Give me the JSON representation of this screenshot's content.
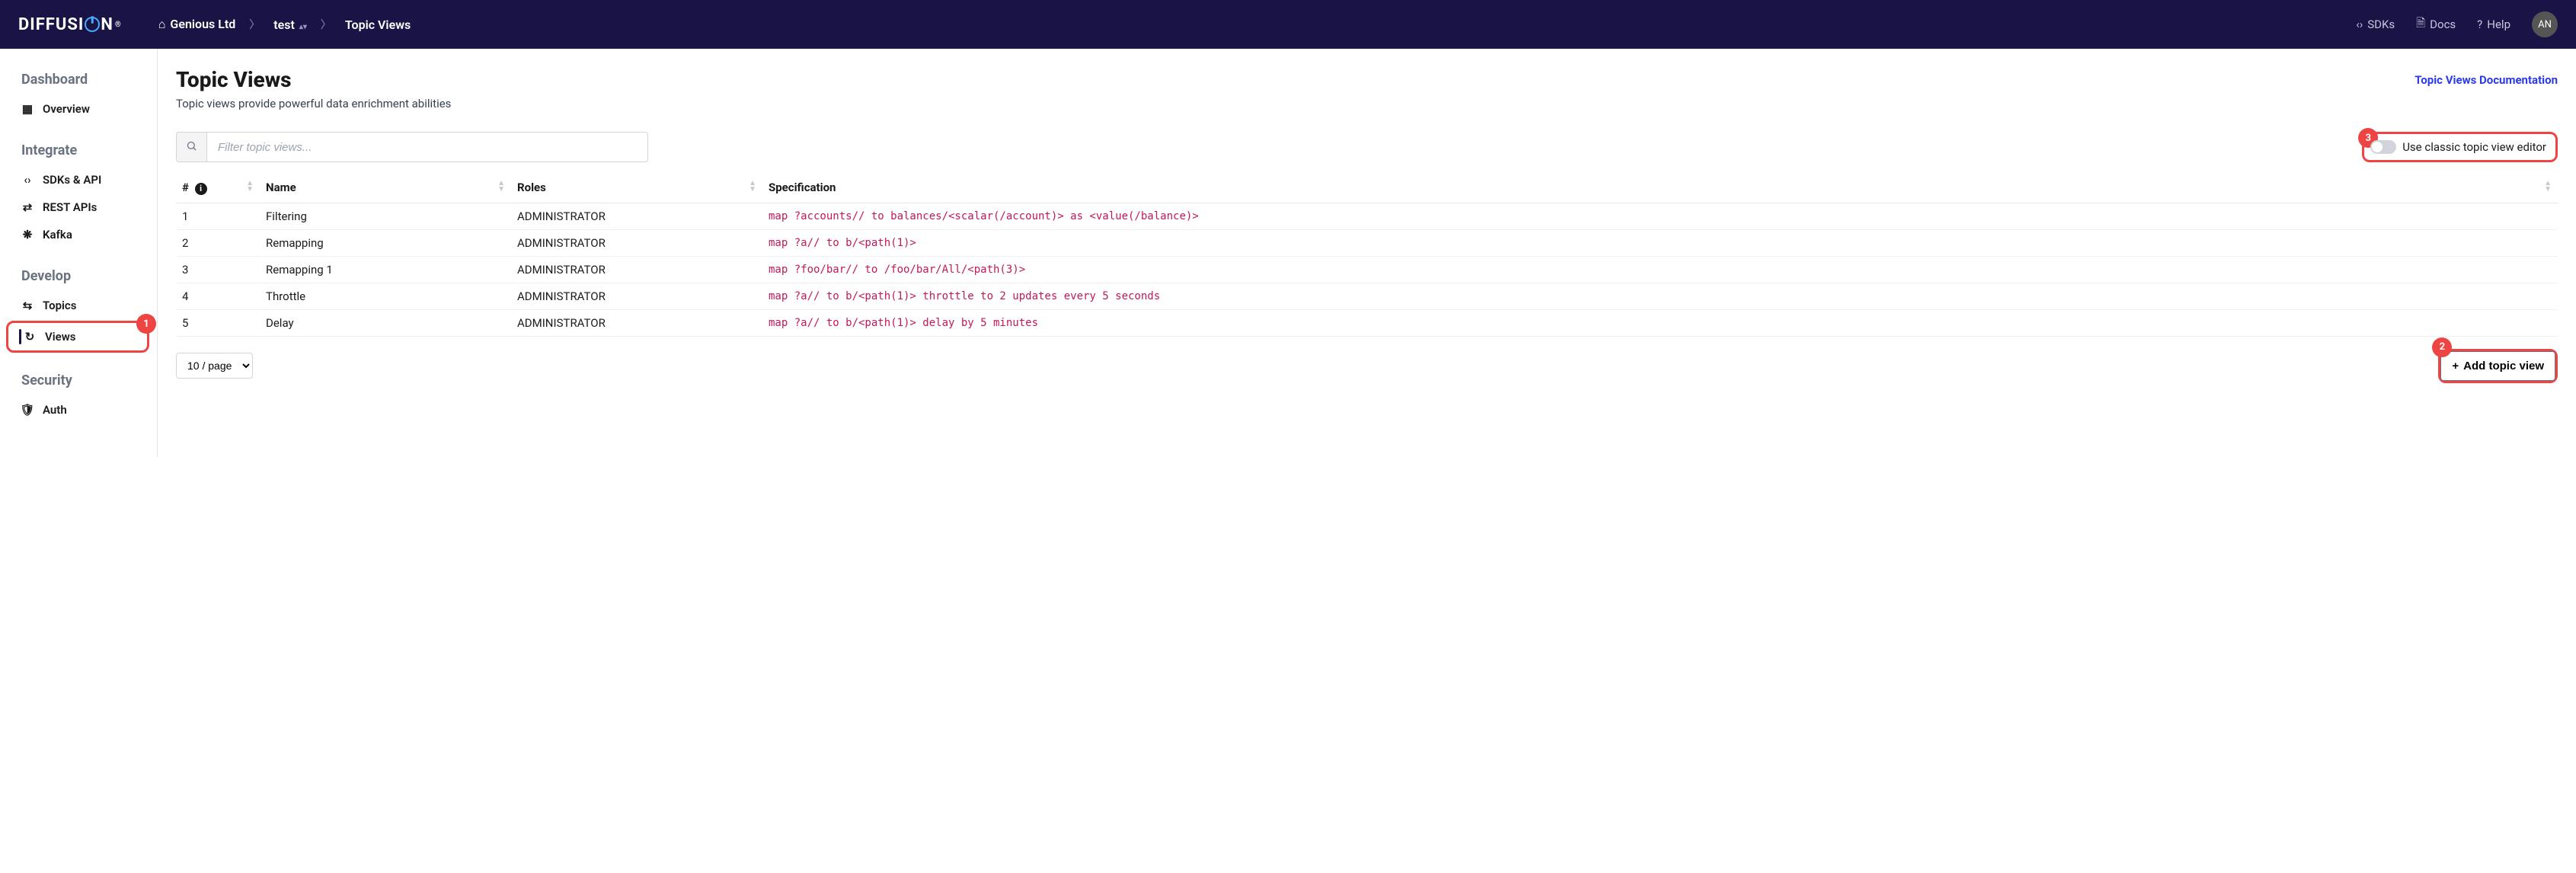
{
  "brand": {
    "pre": "DIFFUSI",
    "post": "N"
  },
  "breadcrumb": {
    "org": "Genious Ltd",
    "project": "test",
    "page": "Topic Views"
  },
  "top_links": {
    "sdks": "SDKs",
    "docs": "Docs",
    "help": "Help"
  },
  "avatar_initials": "AN",
  "sidebar": {
    "dashboard_heading": "Dashboard",
    "overview": "Overview",
    "integrate_heading": "Integrate",
    "sdks_api": "SDKs & API",
    "rest_apis": "REST APIs",
    "kafka": "Kafka",
    "develop_heading": "Develop",
    "topics": "Topics",
    "views": "Views",
    "security_heading": "Security",
    "auth": "Auth"
  },
  "page": {
    "title": "Topic Views",
    "subtitle": "Topic views provide powerful data enrichment abilities",
    "doc_link": "Topic Views Documentation"
  },
  "search": {
    "placeholder": "Filter topic views..."
  },
  "toggle": {
    "label": "Use classic topic view editor"
  },
  "callouts": {
    "c1": "1",
    "c2": "2",
    "c3": "3"
  },
  "columns": {
    "num": "#",
    "name": "Name",
    "roles": "Roles",
    "spec": "Specification"
  },
  "rows": [
    {
      "n": "1",
      "name": "Filtering",
      "roles": "ADMINISTRATOR",
      "spec": "map ?accounts// to balances/<scalar(/account)> as <value(/balance)>"
    },
    {
      "n": "2",
      "name": "Remapping",
      "roles": "ADMINISTRATOR",
      "spec": "map ?a// to b/<path(1)>"
    },
    {
      "n": "3",
      "name": "Remapping 1",
      "roles": "ADMINISTRATOR",
      "spec": "map ?foo/bar// to /foo/bar/All/<path(3)>"
    },
    {
      "n": "4",
      "name": "Throttle",
      "roles": "ADMINISTRATOR",
      "spec": "map ?a// to b/<path(1)> throttle to 2 updates every 5 seconds"
    },
    {
      "n": "5",
      "name": "Delay",
      "roles": "ADMINISTRATOR",
      "spec": "map ?a// to b/<path(1)> delay by 5 minutes"
    }
  ],
  "footer": {
    "page_size": "10 / page",
    "add_button": "Add topic view"
  }
}
